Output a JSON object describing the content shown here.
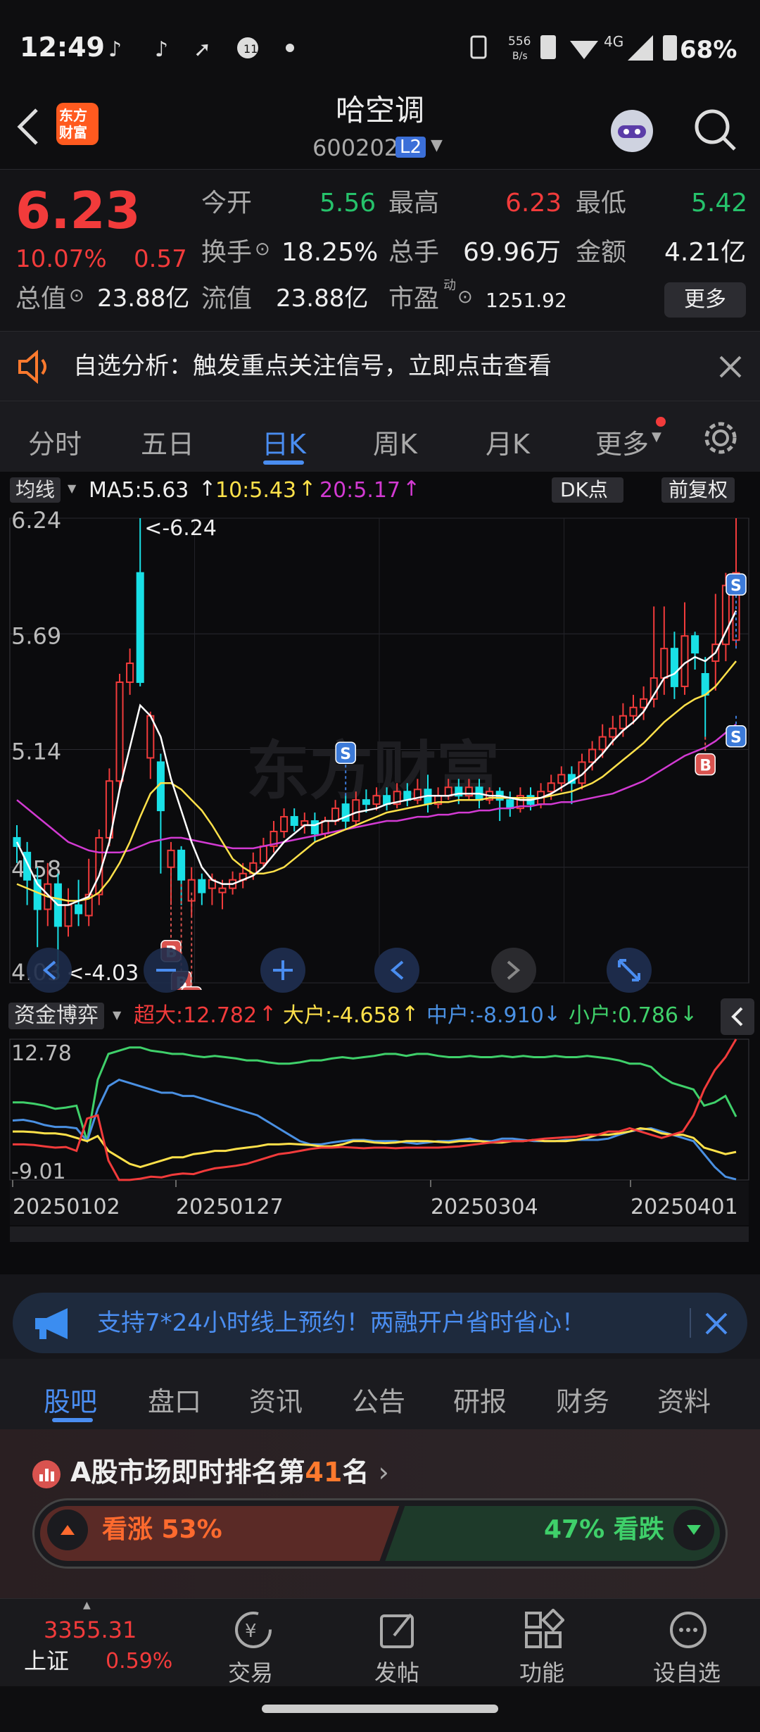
{
  "status": {
    "time": "12:49",
    "net_speed_top": "556",
    "net_speed_bottom": "B/s",
    "network": "4G",
    "battery": "68%"
  },
  "header": {
    "logo_line1": "东方",
    "logo_line2": "财富",
    "title": "哈空调",
    "code": "600202",
    "badge": "L2"
  },
  "quote": {
    "price": "6.23",
    "change_pct": "10.07%",
    "change": "0.57",
    "open_label": "今开",
    "open": "5.56",
    "high_label": "最高",
    "high": "6.23",
    "low_label": "最低",
    "low": "5.42",
    "turnover_label": "换手",
    "turnover": "18.25%",
    "volume_label": "总手",
    "volume": "69.96万",
    "amount_label": "金额",
    "amount": "4.21亿",
    "mktcap_label": "总值",
    "mktcap": "23.88亿",
    "float_label": "流值",
    "float": "23.88亿",
    "pe_label": "市盈",
    "pe_sup": "动",
    "pe": "1251.92",
    "more": "更多"
  },
  "alert": {
    "text": "自选分析：触发重点关注信号，立即点击查看"
  },
  "tabs": [
    {
      "label": "分时"
    },
    {
      "label": "五日"
    },
    {
      "label": "日K"
    },
    {
      "label": "周K"
    },
    {
      "label": "月K"
    },
    {
      "label": "更多"
    }
  ],
  "chart_toolbar": {
    "ma_select": "均线",
    "ma5": "MA5:5.63",
    "ma10": "10:5.43",
    "ma20": "20:5.17",
    "dk": "DK点",
    "fq": "前复权"
  },
  "chart_data": [
    {
      "type": "candlestick",
      "title": "",
      "ylim": [
        4.03,
        6.24
      ],
      "y_ticks": [
        "6.24",
        "5.69",
        "5.14",
        "4.58",
        "4.03"
      ],
      "annotations": [
        "<-6.24",
        "<-4.03"
      ],
      "signals": [
        "S",
        "S",
        "S",
        "B",
        "B",
        "B",
        "B"
      ],
      "candles": [
        [
          4.72,
          4.68,
          4.78,
          4.6
        ],
        [
          4.65,
          4.52,
          4.7,
          4.4
        ],
        [
          4.52,
          4.38,
          4.58,
          4.2
        ],
        [
          4.38,
          4.5,
          4.6,
          4.3
        ],
        [
          4.5,
          4.3,
          4.55,
          4.05
        ],
        [
          4.3,
          4.4,
          4.48,
          4.25
        ],
        [
          4.4,
          4.36,
          4.52,
          4.3
        ],
        [
          4.35,
          4.45,
          4.62,
          4.3
        ],
        [
          4.45,
          4.72,
          4.76,
          4.4
        ],
        [
          4.72,
          4.99,
          5.05,
          4.68
        ],
        [
          4.99,
          5.46,
          5.5,
          4.95
        ],
        [
          5.46,
          5.55,
          5.62,
          5.4
        ],
        [
          5.98,
          5.46,
          6.24,
          5.44
        ],
        [
          5.1,
          5.3,
          5.32,
          5.0
        ],
        [
          5.08,
          4.85,
          5.12,
          4.55
        ],
        [
          4.58,
          4.66,
          4.7,
          4.4
        ],
        [
          4.66,
          4.52,
          4.68,
          4.4
        ],
        [
          4.42,
          4.52,
          4.58,
          4.35
        ],
        [
          4.52,
          4.46,
          4.55,
          4.4
        ],
        [
          4.48,
          4.52,
          4.55,
          4.4
        ],
        [
          4.46,
          4.48,
          4.52,
          4.38
        ],
        [
          4.48,
          4.52,
          4.56,
          4.45
        ],
        [
          4.52,
          4.55,
          4.6,
          4.48
        ],
        [
          4.55,
          4.6,
          4.65,
          4.52
        ],
        [
          4.6,
          4.68,
          4.72,
          4.58
        ],
        [
          4.68,
          4.75,
          4.8,
          4.65
        ],
        [
          4.75,
          4.82,
          4.86,
          4.72
        ],
        [
          4.82,
          4.78,
          4.86,
          4.75
        ],
        [
          4.78,
          4.8,
          4.84,
          4.74
        ],
        [
          4.8,
          4.74,
          4.84,
          4.7
        ],
        [
          4.74,
          4.8,
          4.82,
          4.72
        ],
        [
          4.8,
          4.86,
          4.9,
          4.78
        ],
        [
          4.88,
          4.8,
          4.92,
          4.76
        ],
        [
          4.8,
          4.9,
          4.94,
          4.78
        ],
        [
          4.9,
          4.88,
          4.95,
          4.84
        ],
        [
          4.88,
          4.92,
          4.96,
          4.85
        ],
        [
          4.92,
          4.88,
          4.96,
          4.85
        ],
        [
          4.88,
          4.94,
          4.98,
          4.86
        ],
        [
          4.94,
          4.9,
          4.98,
          4.87
        ],
        [
          4.9,
          4.95,
          5.0,
          4.88
        ],
        [
          4.95,
          4.88,
          5.02,
          4.84
        ],
        [
          4.88,
          4.92,
          4.96,
          4.86
        ],
        [
          4.92,
          4.96,
          5.0,
          4.9
        ],
        [
          4.96,
          4.92,
          5.0,
          4.88
        ],
        [
          4.92,
          4.96,
          5.0,
          4.9
        ],
        [
          4.96,
          4.9,
          5.0,
          4.86
        ],
        [
          4.9,
          4.94,
          4.96,
          4.88
        ],
        [
          4.94,
          4.9,
          4.96,
          4.8
        ],
        [
          4.9,
          4.86,
          4.94,
          4.82
        ],
        [
          4.86,
          4.92,
          4.96,
          4.84
        ],
        [
          4.92,
          4.88,
          4.96,
          4.85
        ],
        [
          4.88,
          4.94,
          4.98,
          4.86
        ],
        [
          4.94,
          4.98,
          5.02,
          4.9
        ],
        [
          4.98,
          5.02,
          5.06,
          4.94
        ],
        [
          5.02,
          4.98,
          5.06,
          4.88
        ],
        [
          4.98,
          5.08,
          5.12,
          4.95
        ],
        [
          5.08,
          5.14,
          5.18,
          5.04
        ],
        [
          5.14,
          5.2,
          5.26,
          5.1
        ],
        [
          5.2,
          5.24,
          5.3,
          5.16
        ],
        [
          5.24,
          5.3,
          5.36,
          5.2
        ],
        [
          5.3,
          5.34,
          5.4,
          5.26
        ],
        [
          5.34,
          5.38,
          5.44,
          5.28
        ],
        [
          5.38,
          5.48,
          5.82,
          5.34
        ],
        [
          5.48,
          5.62,
          5.82,
          5.4
        ],
        [
          5.62,
          5.44,
          5.7,
          5.38
        ],
        [
          5.44,
          5.68,
          5.84,
          5.4
        ],
        [
          5.68,
          5.6,
          5.7,
          5.52
        ],
        [
          5.5,
          5.4,
          5.58,
          5.2
        ],
        [
          5.56,
          5.64,
          5.88,
          5.42
        ],
        [
          5.64,
          5.92,
          5.98,
          5.56
        ],
        [
          5.66,
          5.98,
          6.24,
          5.62
        ]
      ],
      "ma5": [
        4.7,
        4.6,
        4.5,
        4.45,
        4.4,
        4.4,
        4.42,
        4.44,
        4.54,
        4.7,
        4.95,
        5.15,
        5.35,
        5.3,
        5.2,
        5.0,
        4.85,
        4.7,
        4.58,
        4.52,
        4.5,
        4.5,
        4.52,
        4.54,
        4.58,
        4.64,
        4.7,
        4.74,
        4.78,
        4.78,
        4.8,
        4.8,
        4.82,
        4.84,
        4.85,
        4.86,
        4.88,
        4.89,
        4.9,
        4.91,
        4.92,
        4.92,
        4.92,
        4.93,
        4.93,
        4.93,
        4.92,
        4.92,
        4.91,
        4.9,
        4.9,
        4.91,
        4.93,
        4.96,
        4.99,
        5.02,
        5.07,
        5.12,
        5.18,
        5.23,
        5.27,
        5.32,
        5.4,
        5.48,
        5.5,
        5.55,
        5.58,
        5.56,
        5.6,
        5.7,
        5.8
      ],
      "ma10": [
        4.5,
        4.48,
        4.46,
        4.44,
        4.43,
        4.42,
        4.42,
        4.43,
        4.46,
        4.52,
        4.6,
        4.7,
        4.82,
        4.93,
        4.98,
        4.98,
        4.95,
        4.9,
        4.85,
        4.78,
        4.7,
        4.62,
        4.58,
        4.55,
        4.55,
        4.56,
        4.58,
        4.62,
        4.66,
        4.7,
        4.72,
        4.74,
        4.76,
        4.78,
        4.8,
        4.82,
        4.84,
        4.85,
        4.86,
        4.87,
        4.88,
        4.89,
        4.89,
        4.9,
        4.9,
        4.9,
        4.91,
        4.91,
        4.91,
        4.91,
        4.91,
        4.91,
        4.92,
        4.93,
        4.94,
        4.96,
        4.98,
        5.01,
        5.05,
        5.09,
        5.13,
        5.17,
        5.22,
        5.27,
        5.31,
        5.35,
        5.38,
        5.4,
        5.44,
        5.5,
        5.56
      ],
      "ma20": [
        4.9,
        4.86,
        4.82,
        4.78,
        4.74,
        4.7,
        4.68,
        4.66,
        4.65,
        4.65,
        4.65,
        4.66,
        4.68,
        4.7,
        4.71,
        4.72,
        4.72,
        4.71,
        4.7,
        4.69,
        4.68,
        4.67,
        4.67,
        4.67,
        4.68,
        4.69,
        4.7,
        4.71,
        4.72,
        4.73,
        4.74,
        4.75,
        4.76,
        4.77,
        4.78,
        4.79,
        4.8,
        4.8,
        4.81,
        4.82,
        4.82,
        4.83,
        4.83,
        4.84,
        4.84,
        4.85,
        4.85,
        4.86,
        4.86,
        4.87,
        4.87,
        4.88,
        4.88,
        4.89,
        4.89,
        4.9,
        4.91,
        4.92,
        4.93,
        4.95,
        4.97,
        4.99,
        5.02,
        5.05,
        5.08,
        5.11,
        5.13,
        5.15,
        5.18,
        5.22,
        5.26
      ]
    },
    {
      "type": "line",
      "title": "",
      "ylim": [
        -9.01,
        12.78
      ],
      "y_ticks": [
        "12.78",
        "-9.01"
      ],
      "x_ticks": [
        "20250102",
        "20250127",
        "20250304",
        "20250401"
      ],
      "series": [
        {
          "name": "超大",
          "color": "#f23b3b",
          "values": [
            -3.5,
            -3.5,
            -3.6,
            -3.8,
            -4.0,
            -3.9,
            -4.5,
            0.5,
            1.0,
            -6.0,
            -9.0,
            -9.0,
            -8.8,
            -8.5,
            -8.6,
            -8.2,
            -8.0,
            -8.1,
            -7.6,
            -7.2,
            -7.0,
            -6.8,
            -6.5,
            -6.0,
            -5.5,
            -5.0,
            -4.8,
            -4.5,
            -4.2,
            -4.0,
            -4.0,
            -3.9,
            -4.0,
            -4.1,
            -4.0,
            -4.0,
            -4.1,
            -4.0,
            -4.0,
            -4.0,
            -4.0,
            -3.9,
            -3.8,
            -3.6,
            -3.4,
            -3.2,
            -3.0,
            -3.0,
            -3.0,
            -2.8,
            -2.6,
            -2.5,
            -2.4,
            -2.3,
            -2.0,
            -2.0,
            -1.5,
            -1.5,
            -1.0,
            -1.5,
            -2.0,
            -2.5,
            -2.0,
            -1.5,
            1.0,
            5.0,
            8.0,
            10.0,
            12.78
          ]
        },
        {
          "name": "大户",
          "color": "#ffe14a",
          "values": [
            -1.5,
            -1.5,
            -1.6,
            -1.8,
            -1.8,
            -2.0,
            -2.5,
            -3.0,
            -2.2,
            -4.5,
            -5.5,
            -6.5,
            -7.0,
            -6.5,
            -6.0,
            -5.5,
            -5.5,
            -5.0,
            -4.8,
            -4.5,
            -4.5,
            -4.2,
            -4.0,
            -3.8,
            -3.5,
            -3.5,
            -3.4,
            -3.5,
            -3.6,
            -3.8,
            -3.8,
            -3.5,
            -3.0,
            -3.0,
            -3.2,
            -3.3,
            -3.2,
            -3.0,
            -3.0,
            -3.0,
            -3.1,
            -3.2,
            -3.0,
            -3.0,
            -3.0,
            -3.2,
            -3.2,
            -3.0,
            -3.0,
            -2.8,
            -3.0,
            -3.0,
            -3.0,
            -2.8,
            -2.5,
            -2.0,
            -2.0,
            -1.8,
            -1.5,
            -1.0,
            -1.2,
            -1.8,
            -2.0,
            -2.0,
            -2.5,
            -4.0,
            -4.5,
            -5.0,
            -4.658
          ]
        },
        {
          "name": "中户",
          "color": "#4a90e2",
          "values": [
            0.2,
            0.3,
            0.0,
            -0.5,
            -0.8,
            -0.8,
            -1.0,
            -3.0,
            2.0,
            5.5,
            6.5,
            6.0,
            5.5,
            5.0,
            4.5,
            4.5,
            4.0,
            4.0,
            3.5,
            3.0,
            2.5,
            2.0,
            1.5,
            1.0,
            0.0,
            -1.0,
            -2.0,
            -3.0,
            -3.5,
            -3.5,
            -3.2,
            -3.0,
            -2.8,
            -2.8,
            -3.0,
            -3.0,
            -3.0,
            -3.2,
            -3.4,
            -3.2,
            -3.0,
            -3.0,
            -2.8,
            -2.6,
            -3.0,
            -3.0,
            -2.6,
            -2.6,
            -2.8,
            -3.0,
            -3.0,
            -3.0,
            -2.8,
            -2.8,
            -2.8,
            -2.8,
            -2.6,
            -2.0,
            -1.5,
            -1.2,
            -1.0,
            -1.5,
            -2.0,
            -2.5,
            -3.0,
            -5.0,
            -7.0,
            -8.5,
            -8.91
          ]
        },
        {
          "name": "小户",
          "color": "#3fd06a",
          "values": [
            3.0,
            3.0,
            2.8,
            2.5,
            2.0,
            2.2,
            2.5,
            -3.0,
            6.5,
            10.5,
            11.0,
            11.5,
            11.5,
            11.0,
            10.8,
            10.5,
            10.5,
            10.2,
            10.0,
            10.2,
            10.0,
            9.8,
            9.5,
            9.5,
            9.2,
            9.0,
            9.0,
            9.2,
            9.5,
            9.5,
            9.8,
            10.0,
            9.8,
            10.0,
            10.2,
            10.5,
            10.5,
            10.2,
            10.5,
            10.5,
            10.2,
            10.0,
            10.0,
            10.2,
            10.0,
            10.0,
            10.2,
            10.0,
            10.2,
            10.0,
            10.0,
            10.2,
            10.0,
            10.0,
            10.2,
            10.0,
            9.8,
            9.5,
            9.0,
            9.0,
            8.5,
            7.0,
            6.0,
            5.5,
            5.0,
            2.5,
            3.0,
            4.0,
            0.786
          ]
        }
      ]
    }
  ],
  "fund_toolbar": {
    "select": "资金博弈",
    "s1": "超大:12.782",
    "s2": "大户:-4.658",
    "s3": "中户:-8.910",
    "s4": "小户:0.786"
  },
  "banner": {
    "text": "支持7*24小时线上预约！两融开户省时省心！"
  },
  "ftabs": [
    {
      "label": "股吧"
    },
    {
      "label": "盘口"
    },
    {
      "label": "资讯"
    },
    {
      "label": "公告"
    },
    {
      "label": "研报"
    },
    {
      "label": "财务"
    },
    {
      "label": "资料"
    }
  ],
  "rank": {
    "prefix": "A股市场即时排名第",
    "num": "41",
    "suffix": "名",
    "up_label": "看涨 53%",
    "down_label": "47% 看跌",
    "up_pct": 53
  },
  "bottomnav": {
    "index_value": "3355.31",
    "index_name": "上证",
    "index_pct": "0.59%",
    "trade": "交易",
    "post": "发帖",
    "func": "功能",
    "watch": "设自选"
  },
  "colors": {
    "up": "#f23b3b",
    "down": "#26c26b",
    "accent": "#3b82f6",
    "cyan": "#19e0e6"
  }
}
